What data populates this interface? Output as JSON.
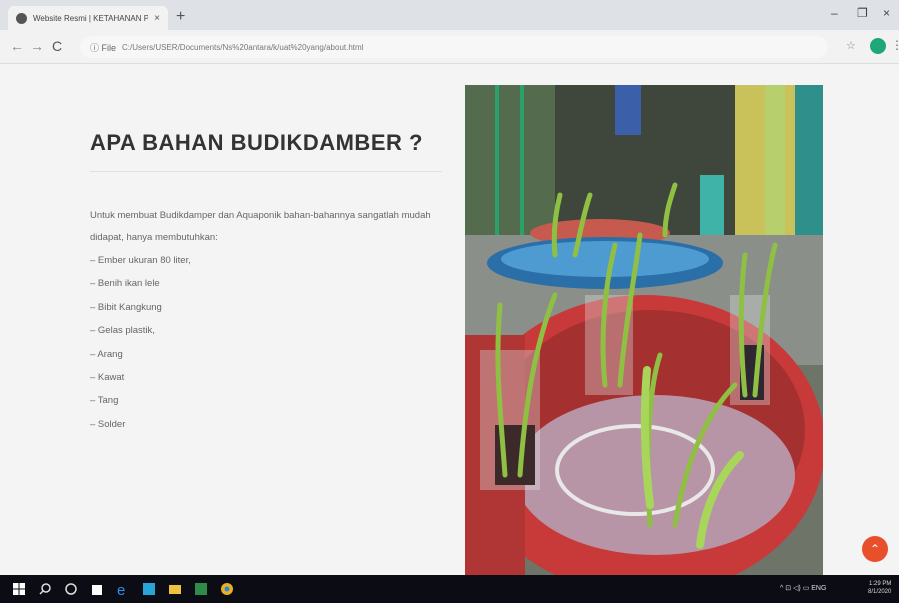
{
  "browser": {
    "tab_title": "Website Resmi | KETAHANAN P...",
    "tab_close": "×",
    "new_tab": "+",
    "minimize": "–",
    "restore": "❐",
    "close": "×",
    "back": "←",
    "forward": "→",
    "reload": "C",
    "info_label": "ⓘ File",
    "url": "C:/Users/USER/Documents/Ns%20antara/k/uat%20yang/about.html",
    "star": "☆",
    "menu": "⋮"
  },
  "page": {
    "heading": "APA BAHAN BUDIKDAMBER ?",
    "intro": "Untuk membuat Budikdamper dan Aquaponik bahan-bahannya sangatlah mudah didapat, hanya membutuhkan:",
    "items": [
      "– Ember ukuran 80 liter,",
      "– Benih ikan lele",
      "– Bibit Kangkung",
      "– Gelas plastik,",
      "– Arang",
      "– Kawat",
      "– Tang",
      "– Solder"
    ],
    "scroll_top_icon": "chevron-up-icon",
    "scroll_top_glyph": "⌃"
  },
  "taskbar": {
    "tray_text": "^  ⊡  ◁)  ▭  ENG",
    "time": "1:29 PM",
    "date": "8/1/2020"
  },
  "colors": {
    "accent": "#e8502b",
    "taskbar": "#0c0c14"
  }
}
